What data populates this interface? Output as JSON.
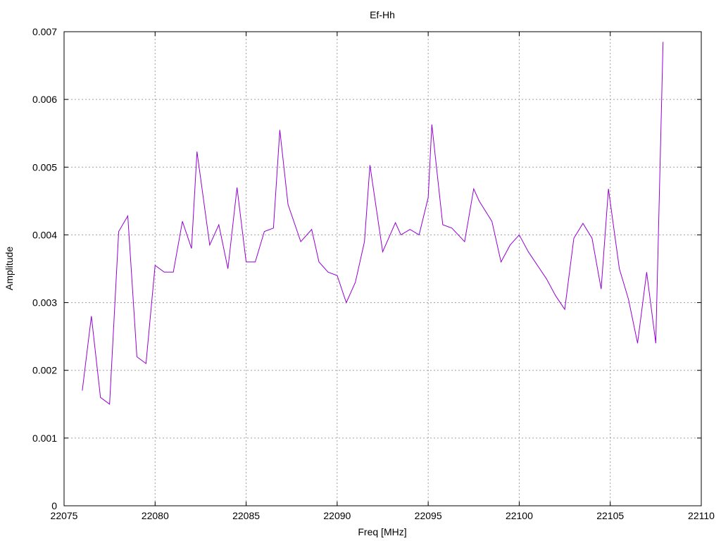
{
  "chart_data": {
    "type": "line",
    "title": "Ef-Hh",
    "xlabel": "Freq [MHz]",
    "ylabel": "Amplitude",
    "xlim": [
      22075,
      22110
    ],
    "ylim": [
      0,
      0.007
    ],
    "x_ticks": [
      "22075",
      "22080",
      "22085",
      "22090",
      "22095",
      "22100",
      "22105",
      "22110"
    ],
    "y_ticks": [
      "0",
      "0.001",
      "0.002",
      "0.003",
      "0.004",
      "0.005",
      "0.006",
      "0.007"
    ],
    "grid": true,
    "legend": "none",
    "colors": {
      "series": "#9400d3",
      "grid": "#a0a0a0",
      "axis": "#000000"
    },
    "series": [
      {
        "values": [
          [
            22076.0,
            0.0017
          ],
          [
            22076.5,
            0.0028
          ],
          [
            22077.0,
            0.0016
          ],
          [
            22077.5,
            0.0015
          ],
          [
            22078.0,
            0.00405
          ],
          [
            22078.5,
            0.00428
          ],
          [
            22079.0,
            0.0022
          ],
          [
            22079.5,
            0.0021
          ],
          [
            22080.0,
            0.00355
          ],
          [
            22080.5,
            0.00345
          ],
          [
            22081.0,
            0.00345
          ],
          [
            22081.5,
            0.0042
          ],
          [
            22082.0,
            0.0038
          ],
          [
            22082.3,
            0.00523
          ],
          [
            22083.0,
            0.00385
          ],
          [
            22083.5,
            0.00415
          ],
          [
            22084.0,
            0.0035
          ],
          [
            22084.5,
            0.0047
          ],
          [
            22085.0,
            0.0036
          ],
          [
            22085.5,
            0.0036
          ],
          [
            22086.0,
            0.00405
          ],
          [
            22086.5,
            0.0041
          ],
          [
            22086.85,
            0.00555
          ],
          [
            22087.3,
            0.00445
          ],
          [
            22088.0,
            0.0039
          ],
          [
            22088.6,
            0.00408
          ],
          [
            22089.0,
            0.0036
          ],
          [
            22089.5,
            0.00345
          ],
          [
            22090.0,
            0.0034
          ],
          [
            22090.5,
            0.003
          ],
          [
            22091.0,
            0.0033
          ],
          [
            22091.5,
            0.0039
          ],
          [
            22091.8,
            0.00503
          ],
          [
            22092.5,
            0.00375
          ],
          [
            22093.2,
            0.00418
          ],
          [
            22093.5,
            0.004
          ],
          [
            22094.0,
            0.00408
          ],
          [
            22094.5,
            0.004
          ],
          [
            22095.0,
            0.00455
          ],
          [
            22095.2,
            0.00563
          ],
          [
            22095.8,
            0.00415
          ],
          [
            22096.3,
            0.0041
          ],
          [
            22097.0,
            0.0039
          ],
          [
            22097.5,
            0.00468
          ],
          [
            22097.8,
            0.0045
          ],
          [
            22098.5,
            0.0042
          ],
          [
            22099.0,
            0.0036
          ],
          [
            22099.5,
            0.00385
          ],
          [
            22100.0,
            0.004
          ],
          [
            22100.5,
            0.00375
          ],
          [
            22101.0,
            0.00355
          ],
          [
            22101.5,
            0.00335
          ],
          [
            22102.0,
            0.0031
          ],
          [
            22102.5,
            0.0029
          ],
          [
            22103.0,
            0.00395
          ],
          [
            22103.5,
            0.00417
          ],
          [
            22104.0,
            0.00395
          ],
          [
            22104.5,
            0.0032
          ],
          [
            22104.9,
            0.00468
          ],
          [
            22105.5,
            0.0035
          ],
          [
            22106.0,
            0.00305
          ],
          [
            22106.5,
            0.0024
          ],
          [
            22107.0,
            0.00345
          ],
          [
            22107.5,
            0.0024
          ],
          [
            22107.9,
            0.00685
          ]
        ]
      }
    ]
  }
}
